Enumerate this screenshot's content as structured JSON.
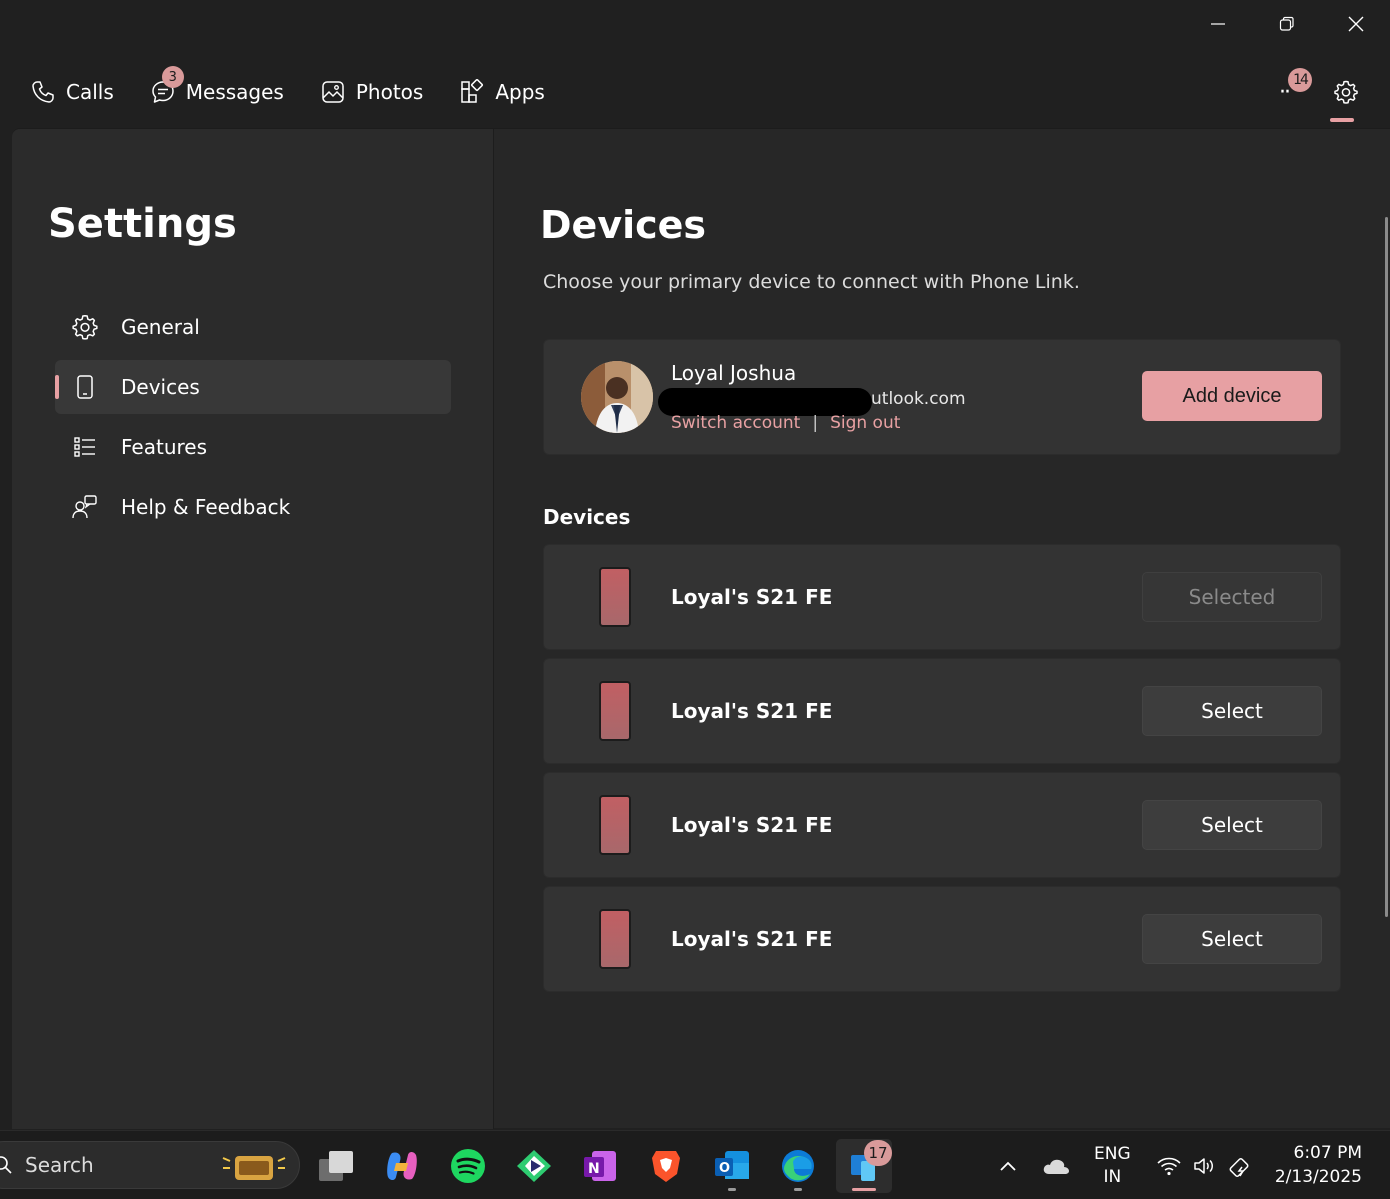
{
  "window_controls": {
    "minimize": "minimize-icon",
    "maximize": "restore-icon",
    "close": "close-icon"
  },
  "nav": {
    "calls": "Calls",
    "messages": "Messages",
    "messages_badge": "3",
    "photos": "Photos",
    "apps": "Apps",
    "more_badge": "14"
  },
  "sidebar": {
    "title": "Settings",
    "items": [
      {
        "label": "General",
        "icon": "gear-icon"
      },
      {
        "label": "Devices",
        "icon": "phone-icon"
      },
      {
        "label": "Features",
        "icon": "list-icon"
      },
      {
        "label": "Help & Feedback",
        "icon": "help-icon"
      }
    ]
  },
  "main": {
    "title": "Devices",
    "subtitle": "Choose your primary device to connect with Phone Link.",
    "account": {
      "name": "Loyal Joshua",
      "email_visible": "utlook.com",
      "switch_account": "Switch account",
      "separator": "|",
      "sign_out": "Sign out",
      "add_device": "Add device"
    },
    "devices_heading": "Devices",
    "devices": [
      {
        "name": "Loyal's S21 FE",
        "button": "Selected"
      },
      {
        "name": "Loyal's S21 FE",
        "button": "Select"
      },
      {
        "name": "Loyal's S21 FE",
        "button": "Select"
      },
      {
        "name": "Loyal's S21 FE",
        "button": "Select"
      }
    ]
  },
  "taskbar": {
    "search_placeholder": "Search",
    "active_app_badge": "17",
    "lang_line1": "ENG",
    "lang_line2": "IN",
    "time": "6:07 PM",
    "date": "2/13/2025"
  },
  "colors": {
    "accent": "#e7a0a3",
    "background": "#202020",
    "card": "#333333"
  }
}
